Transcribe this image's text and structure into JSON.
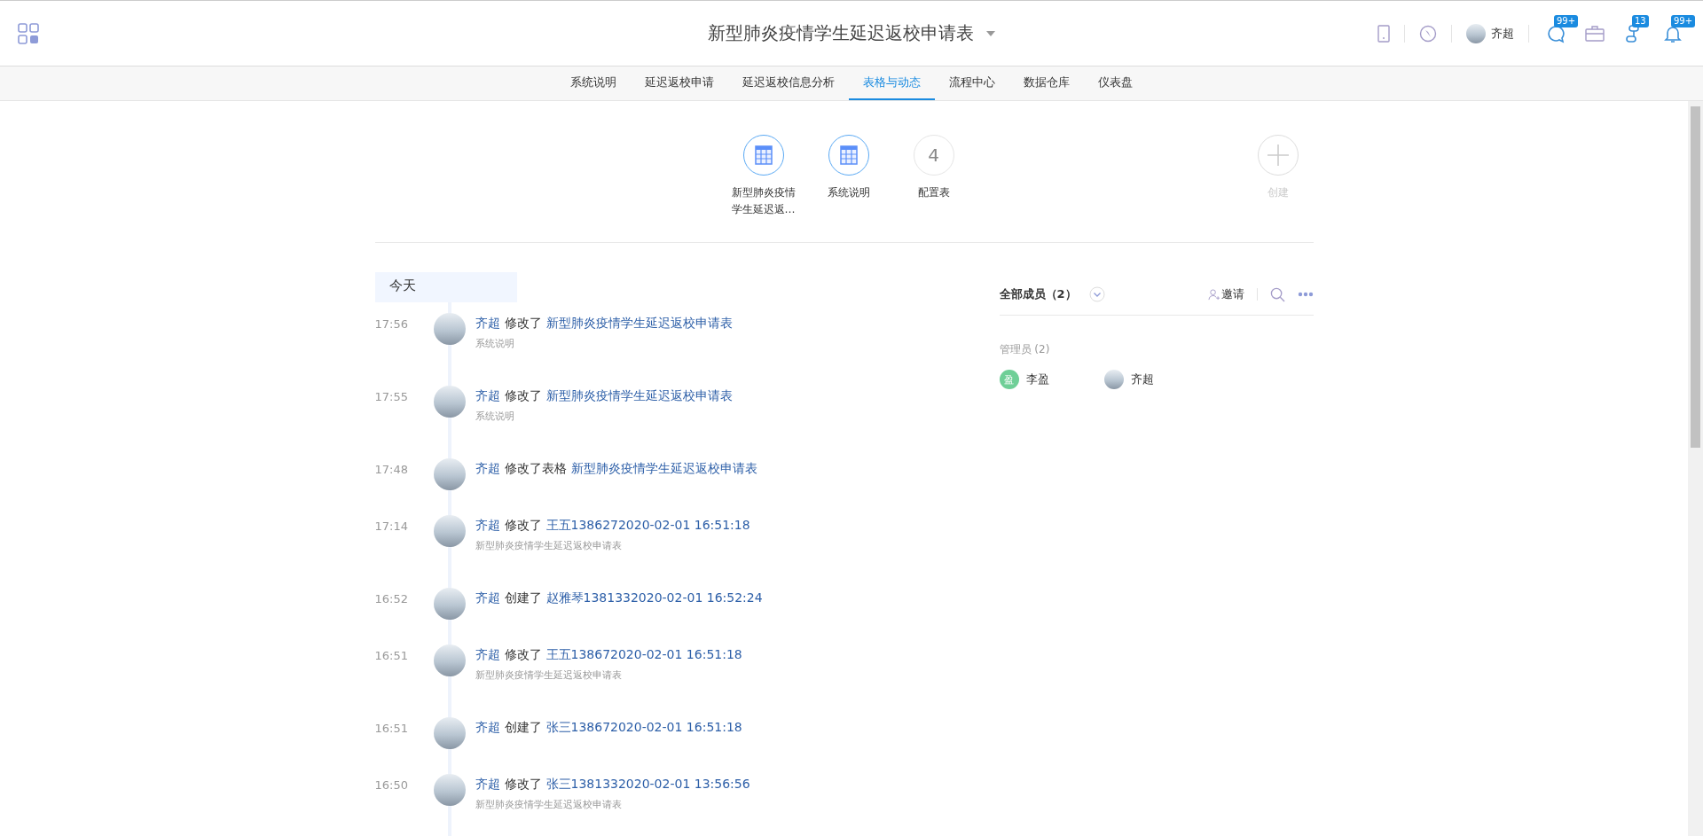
{
  "header": {
    "title": "新型肺炎疫情学生延迟返校申请表",
    "user": "齐超",
    "badges": [
      {
        "kind": "chat",
        "count": "99+"
      },
      {
        "kind": "briefcase"
      },
      {
        "kind": "flow",
        "count": "13"
      },
      {
        "kind": "bell",
        "count": "99+"
      }
    ]
  },
  "tabs": [
    {
      "label": "系统说明",
      "selected": false
    },
    {
      "label": "延迟返校申请",
      "selected": false
    },
    {
      "label": "延迟返校信息分析",
      "selected": false
    },
    {
      "label": "表格与动态",
      "selected": true
    },
    {
      "label": "流程中心",
      "selected": false
    },
    {
      "label": "数据仓库",
      "selected": false
    },
    {
      "label": "仪表盘",
      "selected": false
    }
  ],
  "apps": [
    {
      "kind": "table",
      "label": "新型肺炎疫情学生延迟返…"
    },
    {
      "kind": "table",
      "label": "系统说明"
    },
    {
      "kind": "count",
      "count": "4",
      "label": "配置表"
    }
  ],
  "create_label": "创建",
  "feed": {
    "day": "今天",
    "items": [
      {
        "time": "17:56",
        "user": "齐超",
        "action": "修改了",
        "target": "新型肺炎疫情学生延迟返校申请表",
        "sub": "系统说明"
      },
      {
        "time": "17:55",
        "user": "齐超",
        "action": "修改了",
        "target": "新型肺炎疫情学生延迟返校申请表",
        "sub": "系统说明"
      },
      {
        "time": "17:48",
        "user": "齐超",
        "action": "修改了表格",
        "target": "新型肺炎疫情学生延迟返校申请表"
      },
      {
        "time": "17:14",
        "user": "齐超",
        "action": "修改了",
        "target": "王五1386272020-02-01 16:51:18",
        "sub": "新型肺炎疫情学生延迟返校申请表"
      },
      {
        "time": "16:52",
        "user": "齐超",
        "action": "创建了",
        "target": "赵雅琴1381332020-02-01 16:52:24"
      },
      {
        "time": "16:51",
        "user": "齐超",
        "action": "修改了",
        "target": "王五138672020-02-01 16:51:18",
        "sub": "新型肺炎疫情学生延迟返校申请表"
      },
      {
        "time": "16:51",
        "user": "齐超",
        "action": "创建了",
        "target": "张三138672020-02-01 16:51:18"
      },
      {
        "time": "16:50",
        "user": "齐超",
        "action": "修改了",
        "target": "张三1381332020-02-01 13:56:56",
        "sub": "新型肺炎疫情学生延迟返校申请表"
      }
    ]
  },
  "members": {
    "title": "全部成员（2）",
    "invite": "邀请",
    "group": "管理员 (2)",
    "people": [
      {
        "kind": "initial",
        "initial": "盈",
        "name": "李盈",
        "color": "#6fcf97"
      },
      {
        "kind": "photo",
        "name": "齐超"
      }
    ]
  }
}
